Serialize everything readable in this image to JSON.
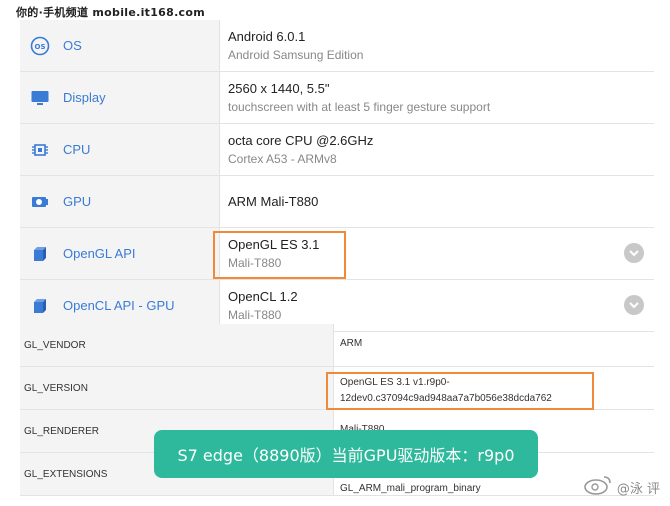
{
  "watermark": {
    "top_text": "你的·手机频道 mobile.it168.com",
    "bottom_text": "@泳 评"
  },
  "specs": [
    {
      "label": "OS",
      "icon": "os-icon",
      "primary": "Android 6.0.1",
      "secondary": "Android Samsung Edition"
    },
    {
      "label": "Display",
      "icon": "monitor-icon",
      "primary": "2560 x 1440, 5.5\"",
      "secondary": "touchscreen with at least 5 finger gesture support"
    },
    {
      "label": "CPU",
      "icon": "cpu-icon",
      "primary": "octa core CPU @2.6GHz",
      "secondary": "Cortex A53 - ARMv8"
    },
    {
      "label": "GPU",
      "icon": "gpu-icon",
      "primary": "ARM Mali-T880",
      "secondary": ""
    },
    {
      "label": "OpenGL API",
      "icon": "cube-icon",
      "primary": "OpenGL ES 3.1",
      "secondary": "Mali-T880"
    },
    {
      "label": "OpenCL API - GPU",
      "icon": "cube-icon",
      "primary": "OpenCL 1.2",
      "secondary": "Mali-T880"
    }
  ],
  "gl": [
    {
      "key": "GL_VENDOR",
      "value": "ARM"
    },
    {
      "key": "GL_VERSION",
      "value_line1": "OpenGL ES 3.1 v1.r9p0-",
      "value_line2": "12dev0.c37094c9ad948aa7a7b056e38dcda762"
    },
    {
      "key": "GL_RENDERER",
      "value": "Mali-T880"
    },
    {
      "key": "GL_EXTENSIONS",
      "value": "GL_ARM_mali_program_binary"
    }
  ],
  "banner_text": "S7 edge（8890版）当前GPU驱动版本：r9p0",
  "colors": {
    "accent": "#3a7bd5",
    "highlight": "#ef8a3a",
    "banner": "#2eb99d"
  }
}
